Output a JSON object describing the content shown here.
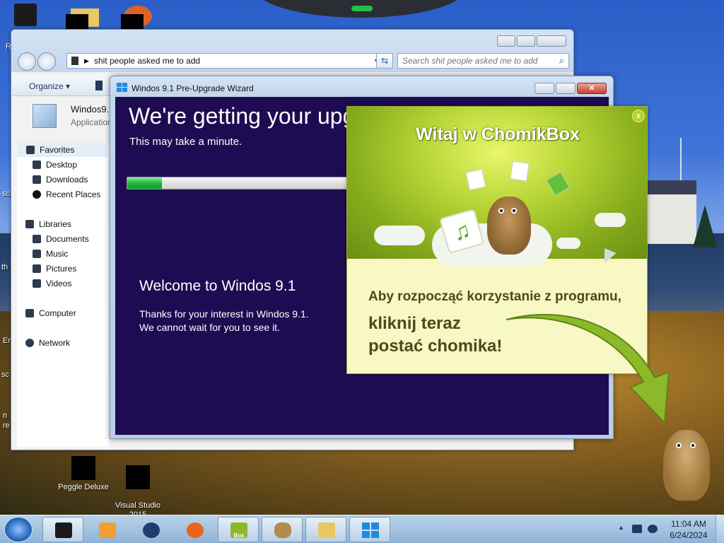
{
  "desktop": {
    "icons": [
      {
        "label": "Peggle Deluxe"
      },
      {
        "label": "Visual Studio\n2015"
      }
    ],
    "edge_texts": [
      "R",
      "sc",
      "th",
      "Er",
      "sc",
      "n",
      "re"
    ]
  },
  "explorer": {
    "address": "shit people asked me to add",
    "search_placeholder": "Search shit people asked me to add",
    "organize_label": "Organize",
    "file": {
      "name": "Windos9.",
      "type": "Application"
    },
    "nav": {
      "favorites": "Favorites",
      "desktop": "Desktop",
      "downloads": "Downloads",
      "recent": "Recent Places",
      "libraries": "Libraries",
      "documents": "Documents",
      "music": "Music",
      "pictures": "Pictures",
      "videos": "Videos",
      "computer": "Computer",
      "network": "Network"
    }
  },
  "wizard": {
    "title": "Windos 9.1 Pre-Upgrade Wizard",
    "heading": "We're getting your upg",
    "subheading": "This may take a minute.",
    "progress": 0.15,
    "welcome": "Welcome to Windos 9.1",
    "thanks_1": "Thanks for your interest in Windos 9.1.",
    "thanks_2": "We cannot wait for you to see it."
  },
  "chomikbox": {
    "title": "Witaj w ChomikBox",
    "close_label": "x",
    "line1": "Aby rozpocząć korzystanie z programu,",
    "line2": "kliknij teraz",
    "line3": "postać chomika!"
  },
  "taskbar": {
    "pinned": [
      "explorer-icon",
      "media-player-icon",
      "globe-icon",
      "firefox-icon",
      "chomikbox-icon",
      "hamster-icon",
      "folder-icon",
      "windows-logo-icon"
    ],
    "pinned_badge": "Box",
    "clock_time": "11:04 AM",
    "clock_date": "6/24/2024"
  },
  "colors": {
    "wizard_bg": "#1e0c52",
    "progress_fill": "#1fb83a",
    "chomik_green": "#86ac1c",
    "chomik_text": "#4a4a1e"
  }
}
